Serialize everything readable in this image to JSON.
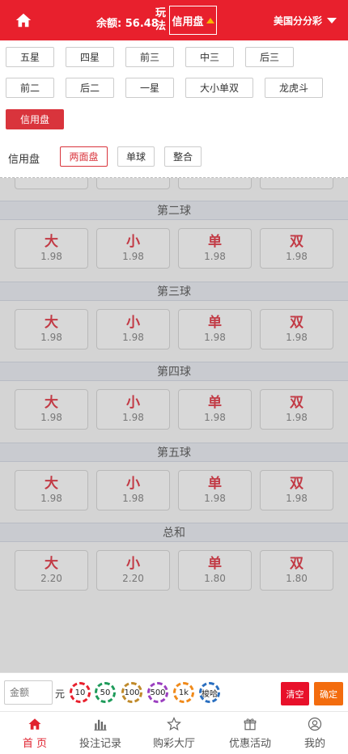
{
  "header": {
    "balance_label": "余额: 56.48",
    "wanfa_label": "玩法",
    "mode_label": "信用盘",
    "game_name": "美国分分彩"
  },
  "categories": [
    "五星",
    "四星",
    "前三",
    "中三",
    "后三",
    "前二",
    "后二",
    "一星",
    "大小单双",
    "龙虎斗",
    "信用盘"
  ],
  "active_category": "信用盘",
  "subtabs": {
    "label": "信用盘",
    "items": [
      "两面盘",
      "单球",
      "整合"
    ],
    "active": "两面盘"
  },
  "sections": [
    {
      "title": "第二球",
      "options": [
        {
          "name": "大",
          "odds": "1.98"
        },
        {
          "name": "小",
          "odds": "1.98"
        },
        {
          "name": "单",
          "odds": "1.98"
        },
        {
          "name": "双",
          "odds": "1.98"
        }
      ]
    },
    {
      "title": "第三球",
      "options": [
        {
          "name": "大",
          "odds": "1.98"
        },
        {
          "name": "小",
          "odds": "1.98"
        },
        {
          "name": "单",
          "odds": "1.98"
        },
        {
          "name": "双",
          "odds": "1.98"
        }
      ]
    },
    {
      "title": "第四球",
      "options": [
        {
          "name": "大",
          "odds": "1.98"
        },
        {
          "name": "小",
          "odds": "1.98"
        },
        {
          "name": "单",
          "odds": "1.98"
        },
        {
          "name": "双",
          "odds": "1.98"
        }
      ]
    },
    {
      "title": "第五球",
      "options": [
        {
          "name": "大",
          "odds": "1.98"
        },
        {
          "name": "小",
          "odds": "1.98"
        },
        {
          "name": "单",
          "odds": "1.98"
        },
        {
          "name": "双",
          "odds": "1.98"
        }
      ]
    },
    {
      "title": "总和",
      "options": [
        {
          "name": "大",
          "odds": "2.20"
        },
        {
          "name": "小",
          "odds": "2.20"
        },
        {
          "name": "单",
          "odds": "1.80"
        },
        {
          "name": "双",
          "odds": "1.80"
        }
      ]
    }
  ],
  "betbar": {
    "amount_placeholder": "金额",
    "unit": "元",
    "chips": [
      {
        "label": "10",
        "color": "#e8202d"
      },
      {
        "label": "50",
        "color": "#1e9b5a"
      },
      {
        "label": "100",
        "color": "#c08a2a"
      },
      {
        "label": "500",
        "color": "#9b3fc0"
      },
      {
        "label": "1k",
        "color": "#f08a1a"
      },
      {
        "label": "梭哈",
        "color": "#2a6fc0"
      }
    ],
    "clear_label": "清空",
    "confirm_label": "确定"
  },
  "nav": [
    {
      "label": "首 页",
      "icon": "home-icon",
      "active": true
    },
    {
      "label": "投注记录",
      "icon": "bar-chart-icon",
      "active": false
    },
    {
      "label": "购彩大厅",
      "icon": "star-icon",
      "active": false
    },
    {
      "label": "优惠活动",
      "icon": "gift-icon",
      "active": false
    },
    {
      "label": "我的",
      "icon": "user-icon",
      "active": false
    }
  ],
  "colors": {
    "brand_red": "#e8202d",
    "confirm_orange": "#f36c0e",
    "odds_name": "#c23a45"
  }
}
